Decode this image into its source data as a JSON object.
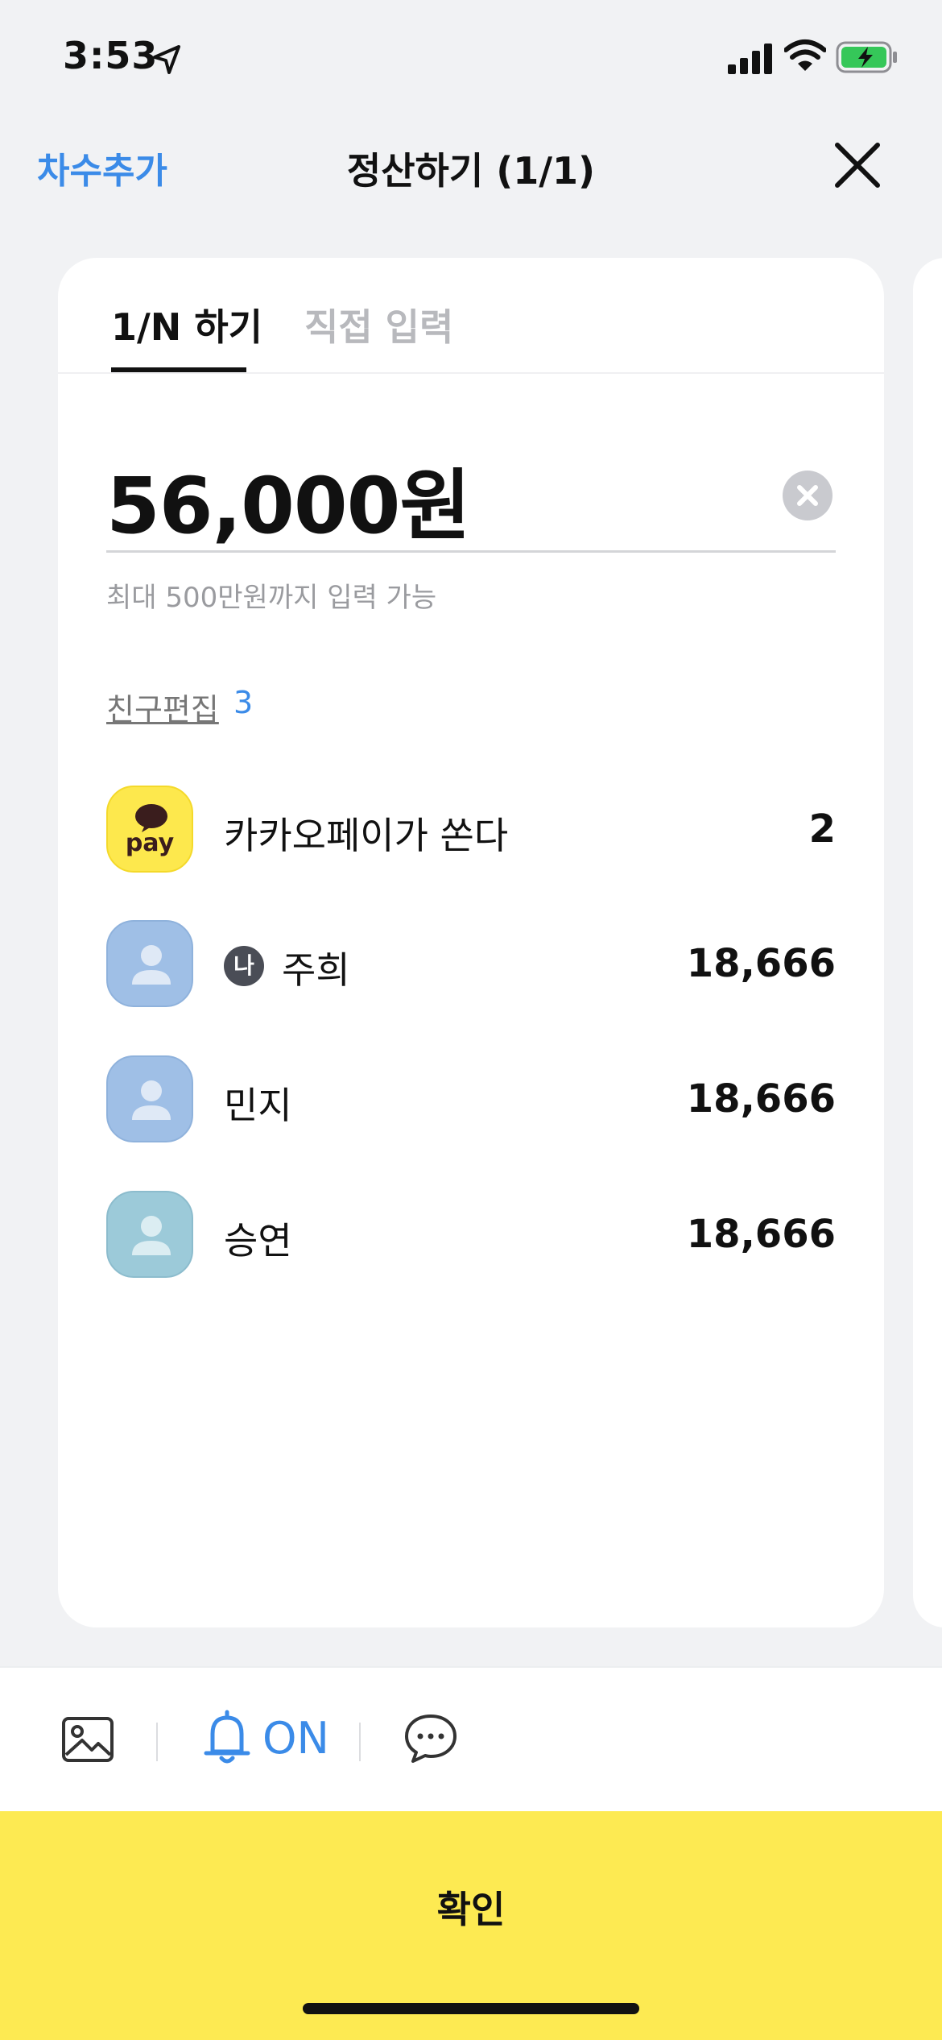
{
  "status_bar": {
    "time": "3:53"
  },
  "header": {
    "add_round": "차수추가",
    "title": "정산하기 (1/1)"
  },
  "tabs": [
    {
      "label": "1/N 하기",
      "active": true
    },
    {
      "label": "직접 입력",
      "active": false
    }
  ],
  "amount": {
    "value": "56,000원",
    "hint": "최대 500만원까지 입력 가능"
  },
  "friends": {
    "edit_label": "친구편집",
    "count": "3",
    "rows": [
      {
        "name": "카카오페이가 쏜다",
        "amount": "2",
        "avatar": "kakaopay-logo",
        "logo_text": "pay"
      },
      {
        "name": "주희",
        "amount": "18,666",
        "avatar": "default-profile",
        "me_badge": "나"
      },
      {
        "name": "민지",
        "amount": "18,666",
        "avatar": "default-profile"
      },
      {
        "name": "승연",
        "amount": "18,666",
        "avatar": "default-profile"
      }
    ]
  },
  "bottom_bar": {
    "notification_label": "ON"
  },
  "confirm": {
    "label": "확인"
  },
  "colors": {
    "accent": "#3b8be8",
    "confirm_bg": "#fdea52",
    "background": "#f1f2f4"
  }
}
